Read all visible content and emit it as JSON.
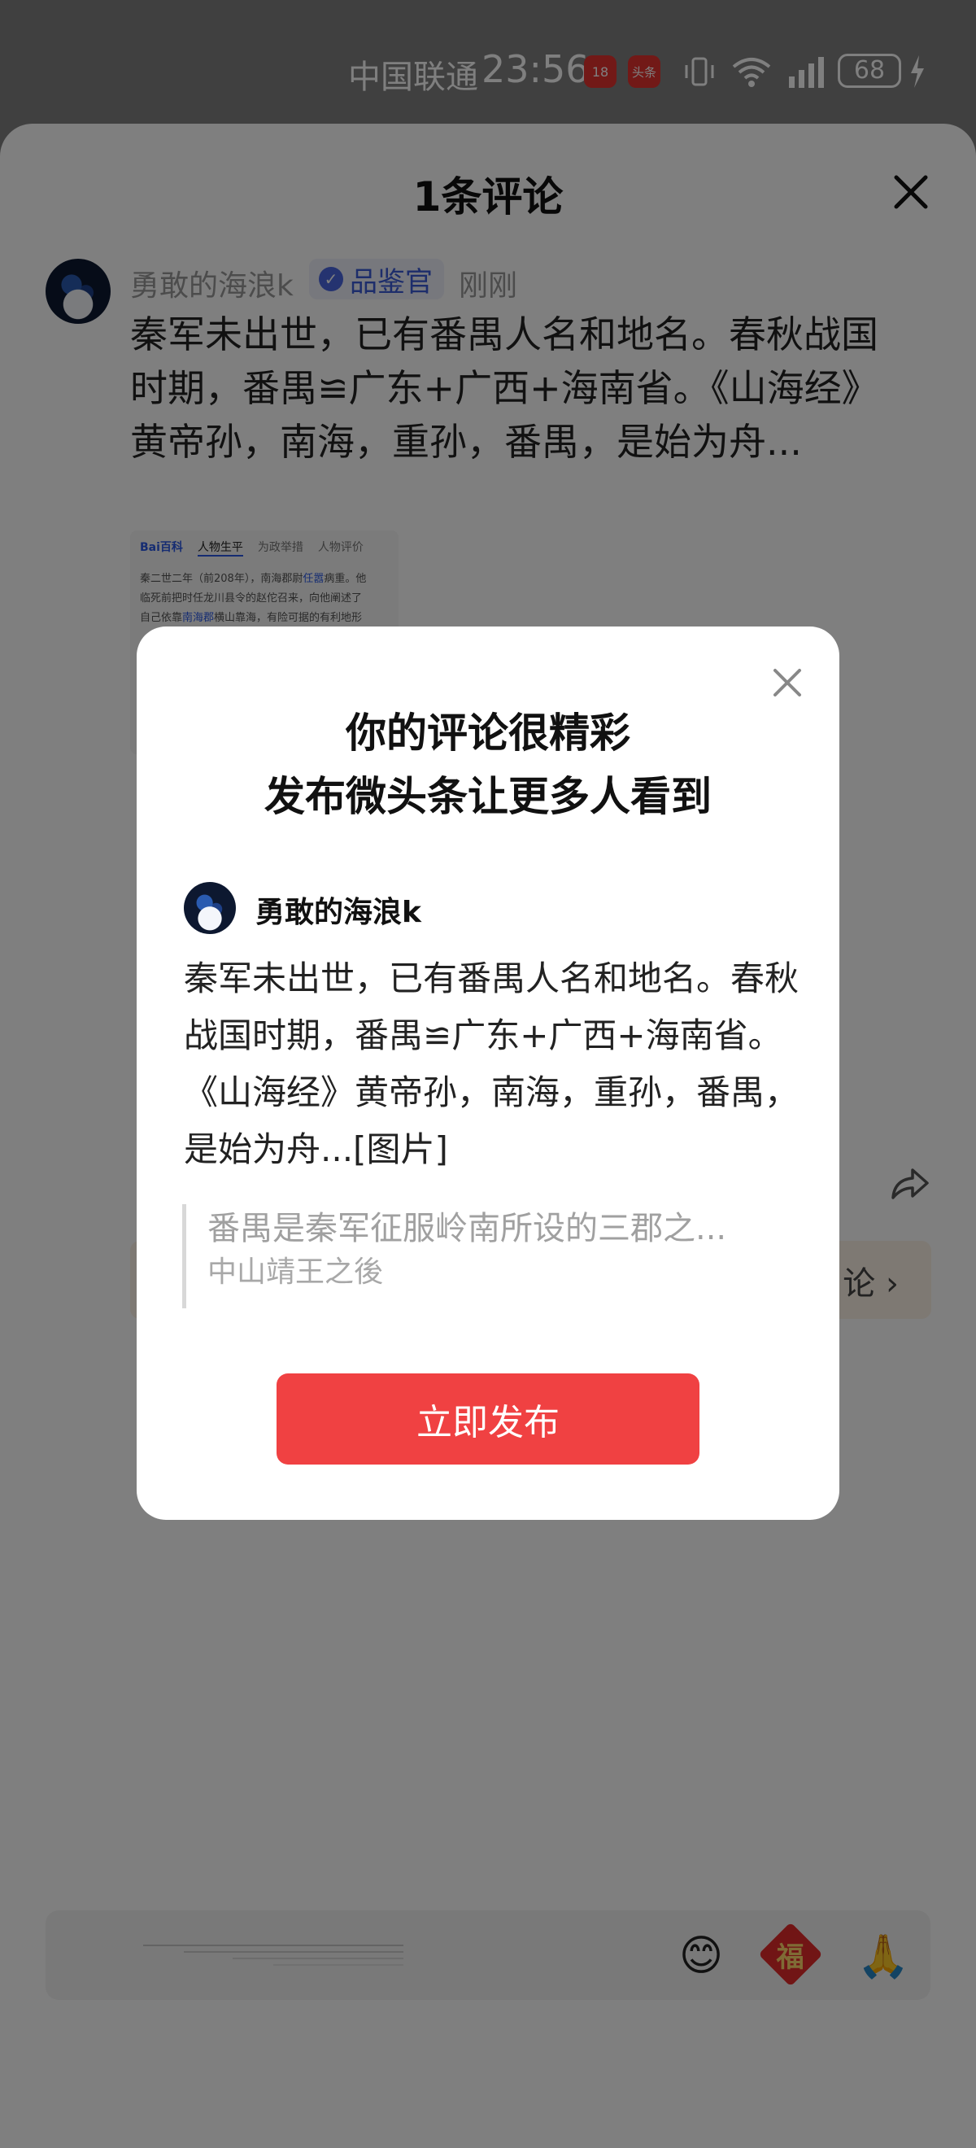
{
  "status_bar": {
    "carrier": "中国联通",
    "time": "23:56",
    "badge_a": "18",
    "badge_b": "头条",
    "battery": "68"
  },
  "comment_sheet": {
    "title": "1条评论",
    "comment": {
      "user_name": "勇敢的海浪k",
      "badge_label": "品鉴官",
      "time": "刚刚",
      "text": "秦军未出世，已有番禺人名和地名。春秋战国时期，番禺≌广东+广西+海南省。《山海经》黄帝孙，南海，重孙，番禺，是始为舟...",
      "image": {
        "logo": "Bai百科",
        "tabs": [
          "人物生平",
          "为政举措",
          "人物评价"
        ],
        "lines": [
          [
            "秦二世二年（前208年），南海郡尉",
            "任嚣",
            "病重。他"
          ],
          [
            "临死前把时任龙川县令的赵佗召来，向他阐述了",
            "",
            ""
          ],
          [
            "自己依靠",
            "南海郡",
            "横山靠海，有险可据的有利地形"
          ]
        ]
      }
    },
    "more_replies_label": "论 ›"
  },
  "bottom_bar": {
    "emoji_smile": "😊",
    "emoji_fu": "福",
    "emoji_hands": "🙏"
  },
  "modal": {
    "title_line1": "你的评论很精彩",
    "title_line2": "发布微头条让更多人看到",
    "user_name": "勇敢的海浪k",
    "text": "秦军未出世，已有番禺人名和地名。春秋战国时期，番禺≌广东+广西+海南省。《山海经》黄帝孙，南海，重孙，番禺，是始为舟...[图片]",
    "quote_text": "番禺是秦军征服岭南所设的三郡之...",
    "quote_author": "中山靖王之後",
    "publish_button": "立即发布"
  },
  "colors": {
    "accent_red": "#f04142",
    "badge_blue": "#3a5ad6",
    "overlay": "rgba(0,0,0,0.5)"
  },
  "icons": {
    "sheet_close": "close-icon",
    "modal_close": "close-icon",
    "share": "share-icon",
    "verified": "check-badge-icon"
  }
}
